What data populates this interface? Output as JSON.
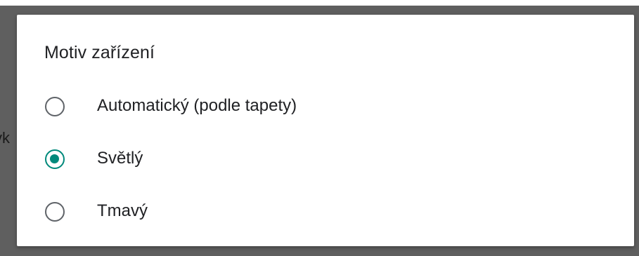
{
  "background": {
    "partial_text": "vk"
  },
  "dialog": {
    "title": "Motiv zařízení",
    "options": [
      {
        "label": "Automatický (podle tapety)",
        "selected": false
      },
      {
        "label": "Světlý",
        "selected": true
      },
      {
        "label": "Tmavý",
        "selected": false
      }
    ]
  },
  "colors": {
    "accent": "#00897b",
    "radio_unchecked": "#5f6368",
    "scrim": "#5f5f5f"
  }
}
